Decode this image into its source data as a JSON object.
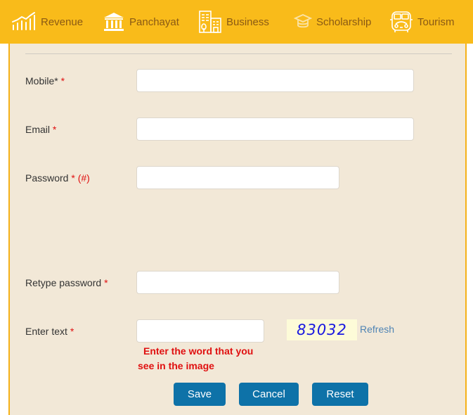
{
  "nav": {
    "items": [
      {
        "label": "Revenue",
        "icon": "chart-growth-icon"
      },
      {
        "label": "Panchayat",
        "icon": "building-columns-icon"
      },
      {
        "label": "Business",
        "icon": "office-buildings-icon"
      },
      {
        "label": "Scholarship",
        "icon": "graduation-cap-icon"
      },
      {
        "label": "Tourism",
        "icon": "bus-icon"
      }
    ]
  },
  "form": {
    "mobile": {
      "label": "Mobile*",
      "required_mark": "*",
      "value": ""
    },
    "email": {
      "label": "Email",
      "required_mark": "*",
      "value": ""
    },
    "password": {
      "label": "Password",
      "required_mark": "*",
      "note": "(#)",
      "value": ""
    },
    "retype_password": {
      "label": "Retype password",
      "required_mark": "*",
      "value": ""
    },
    "captcha": {
      "label": "Enter text",
      "required_mark": "*",
      "value": "",
      "image_text": "83032",
      "refresh_label": "Refresh",
      "hint_line1": "Enter the word that you",
      "hint_line2": "see in the image"
    }
  },
  "buttons": {
    "save": "Save",
    "cancel": "Cancel",
    "reset": "Reset"
  },
  "colors": {
    "nav_bg": "#f9bb1a",
    "panel_bg": "#f2e8d7",
    "button_bg": "#0e72a8",
    "required": "#e01010",
    "captcha_text": "#1a1ae0"
  }
}
